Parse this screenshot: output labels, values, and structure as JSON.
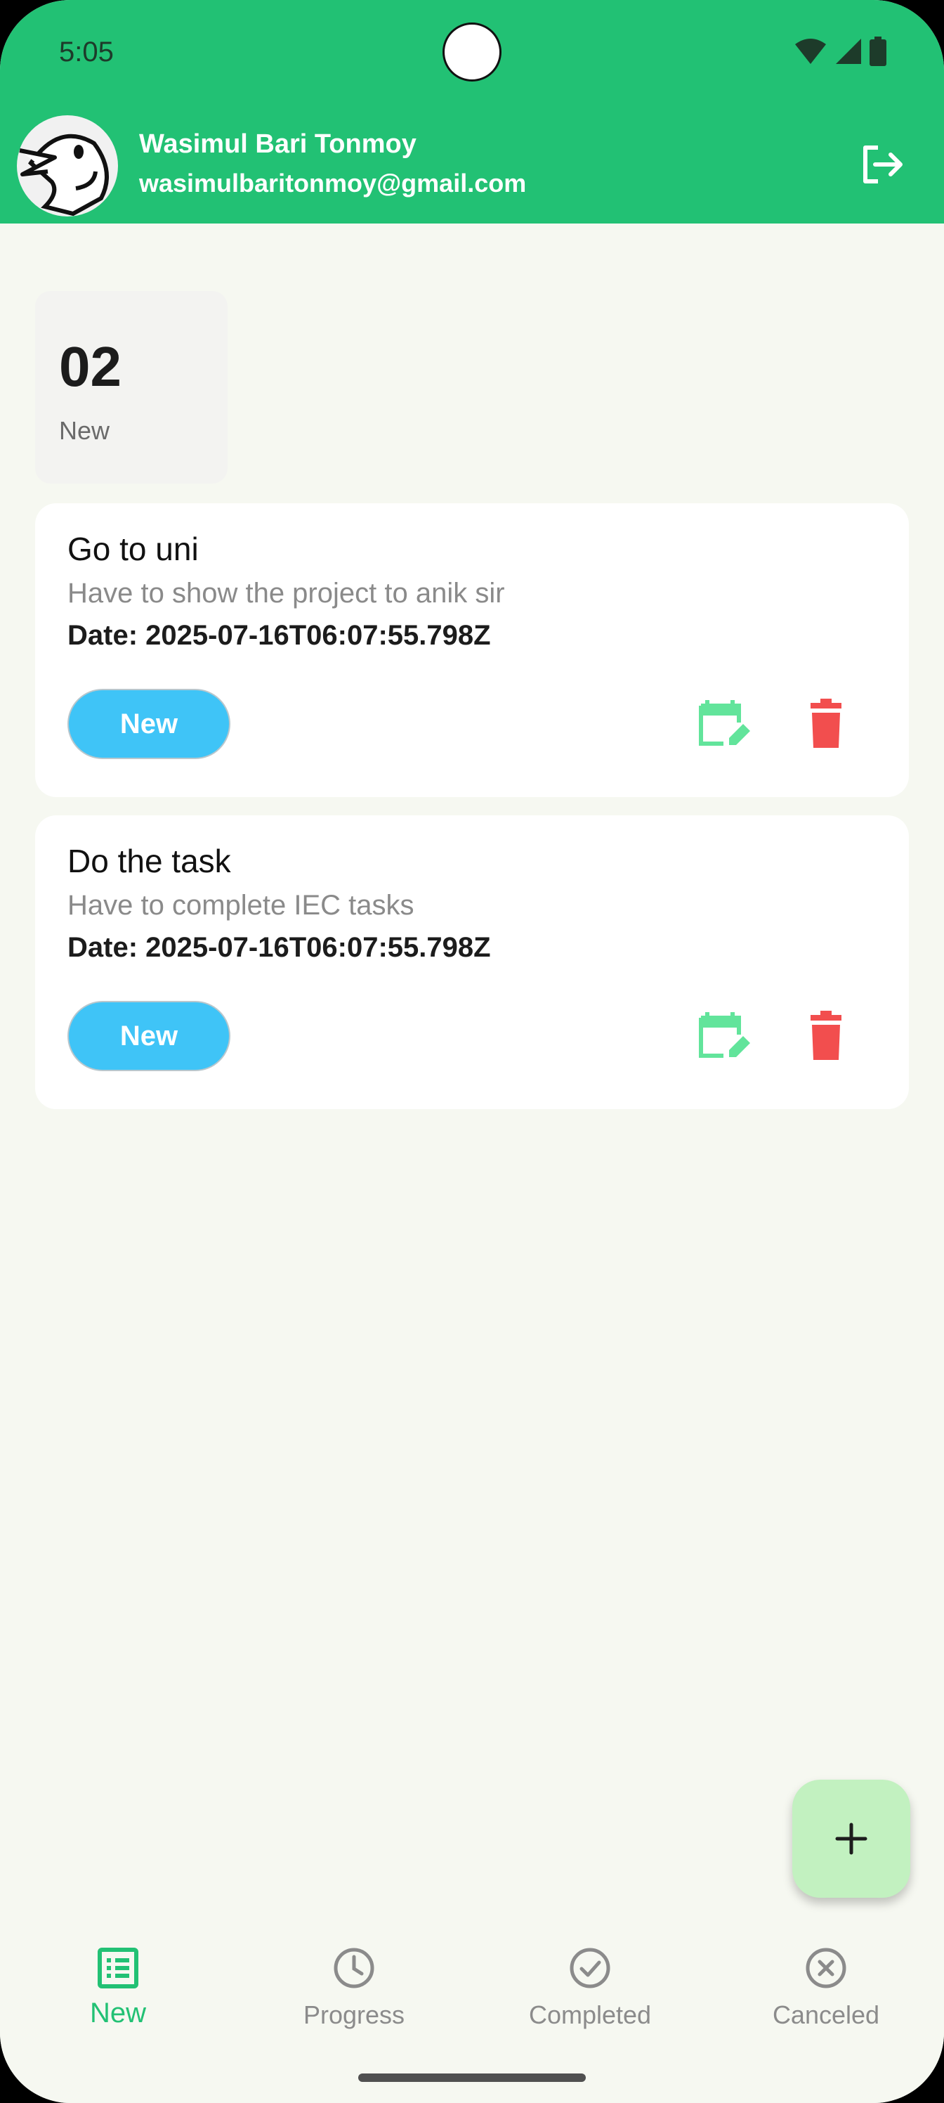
{
  "status_bar": {
    "time": "5:05"
  },
  "header": {
    "user_name": "Wasimul Bari Tonmoy",
    "user_email": "wasimulbaritonmoy@gmail.com",
    "logout_icon": "logout-icon"
  },
  "summary": {
    "count": "02",
    "label": "New"
  },
  "tasks": [
    {
      "title": "Go to uni",
      "description": "Have to show the project to anik sir",
      "date": "Date: 2025-07-16T06:07:55.798Z",
      "status": "New"
    },
    {
      "title": "Do the task",
      "description": "Have to complete IEC tasks",
      "date": "Date: 2025-07-16T06:07:55.798Z",
      "status": "New"
    }
  ],
  "fab": {
    "icon": "plus-icon"
  },
  "bottom_nav": {
    "active": "New",
    "items": [
      {
        "label": "New",
        "icon": "list-icon"
      },
      {
        "label": "Progress",
        "icon": "clock-icon"
      },
      {
        "label": "Completed",
        "icon": "check-circle-icon"
      },
      {
        "label": "Canceled",
        "icon": "cancel-circle-icon"
      }
    ]
  },
  "colors": {
    "primary": "#22c174",
    "chip": "#3fc4f7",
    "edit": "#62e49b",
    "delete": "#f24e4e",
    "fab": "#c2f1c0",
    "background": "#f6f8f1"
  }
}
